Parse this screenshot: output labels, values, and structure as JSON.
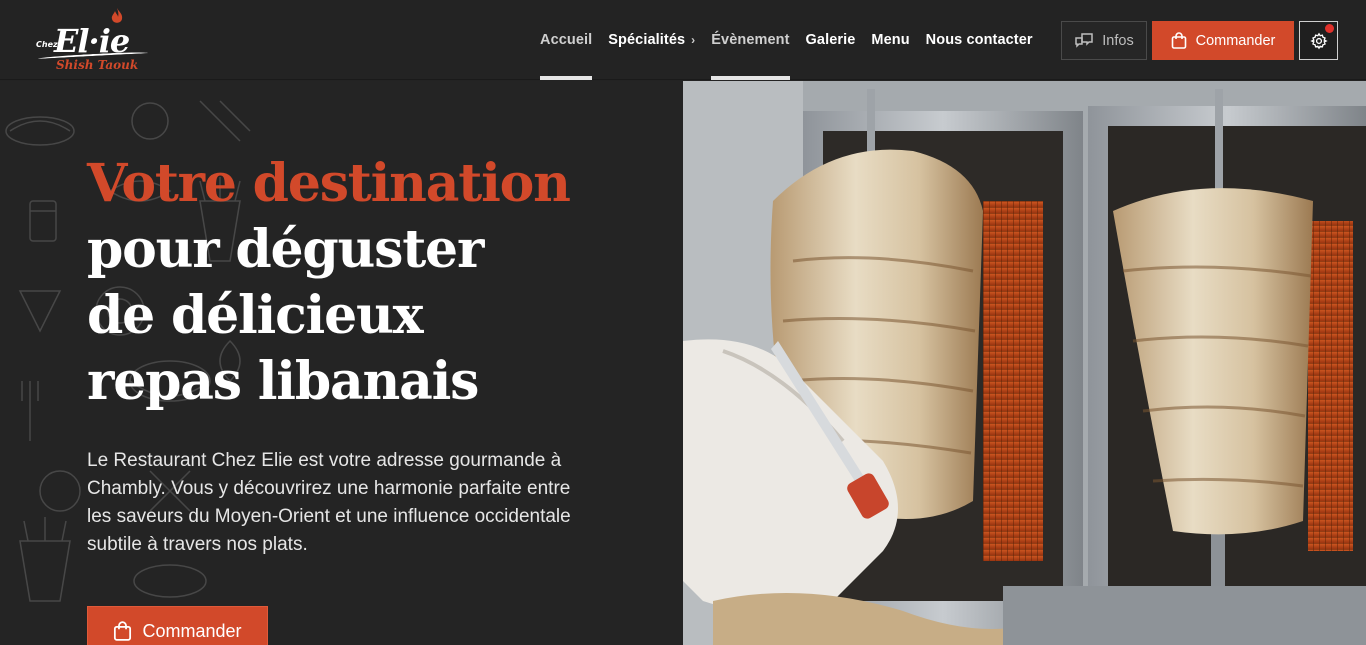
{
  "brand": {
    "logo_prefix": "Chez",
    "logo_name": "El·ie",
    "logo_sub": "Shish Taouk",
    "accent_color": "#d2492a",
    "background": "#232323"
  },
  "nav": {
    "items": [
      {
        "label": "Accueil",
        "active": true
      },
      {
        "label": "Spécialités",
        "has_submenu": true
      },
      {
        "label": "Évènement",
        "active": true
      },
      {
        "label": "Galerie"
      },
      {
        "label": "Menu"
      },
      {
        "label": "Nous contacter"
      }
    ],
    "submenu_chevron": "›"
  },
  "header_actions": {
    "infos_label": "Infos",
    "infos_icon": "chat-bubbles-icon",
    "commander_label": "Commander",
    "commander_icon": "shopping-bag-icon",
    "settings_icon": "gear-icon",
    "notification_dot_color": "#e0312b"
  },
  "hero": {
    "headline_accent": "Votre destination",
    "headline_lines": [
      "pour déguster",
      "de délicieux",
      "repas libanais"
    ],
    "intro": "Le Restaurant Chez Elie est votre adresse gourmande à Chambly. Vous y découvrirez une harmonie parfaite entre les saveurs du Moyen-Orient et une influence occidentale subtile à travers nos plats.",
    "cta_label": "Commander",
    "cta_icon": "shopping-bag-icon",
    "image_subject": "shawarma-rotisserie-photo"
  }
}
